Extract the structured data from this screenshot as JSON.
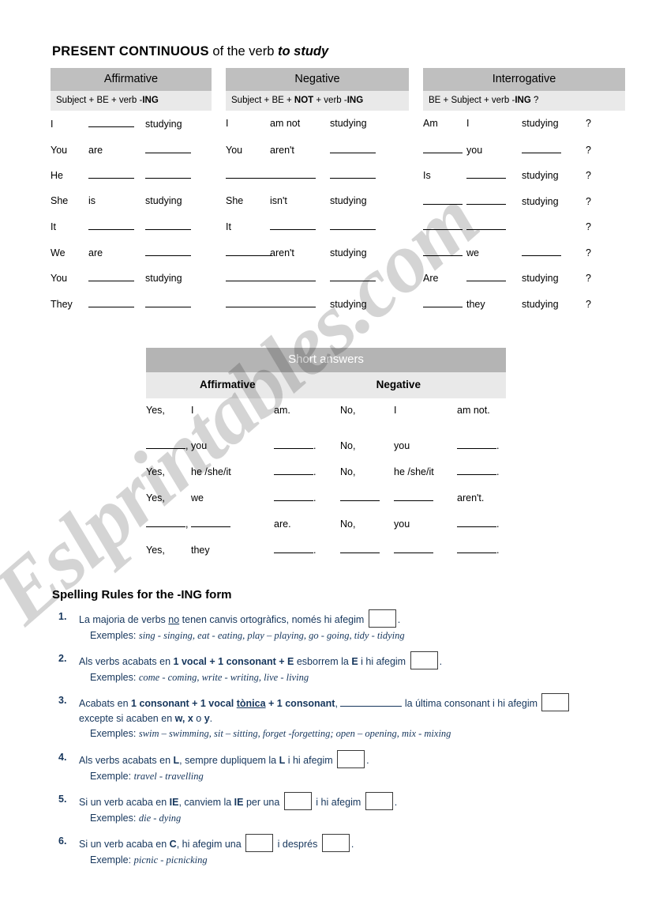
{
  "watermark": {
    "text": "Eslprintables.com"
  },
  "title": {
    "strong": "PRESENT CONTINUOUS",
    "normal": " of the verb ",
    "emphasis": "to study"
  },
  "tables": {
    "affirmative": {
      "header": "Affirmative",
      "formula_plain_1": "Subject + BE + verb -",
      "formula_bold": "ING",
      "rows": [
        {
          "c1": "I",
          "c2": "",
          "c3": "studying"
        },
        {
          "c1": "You",
          "c2": "are",
          "c3": ""
        },
        {
          "c1": "He",
          "c2": "",
          "c3": ""
        },
        {
          "c1": "She",
          "c2": "is",
          "c3": "studying"
        },
        {
          "c1": "It",
          "c2": "",
          "c3": ""
        },
        {
          "c1": "We",
          "c2": "are",
          "c3": ""
        },
        {
          "c1": "You",
          "c2": "",
          "c3": "studying"
        },
        {
          "c1": "They",
          "c2": "",
          "c3": ""
        }
      ]
    },
    "negative": {
      "header": "Negative",
      "formula_plain_1": "Subject + BE + ",
      "formula_bold_1": "NOT",
      "formula_plain_2": " + verb -",
      "formula_bold_2": "ING",
      "rows": [
        {
          "c1": "I",
          "c2": "am not",
          "c3": "studying"
        },
        {
          "c1": "You",
          "c2": "aren't",
          "c3": ""
        },
        {
          "c1": "",
          "c2": "",
          "c3": ""
        },
        {
          "c1": "She",
          "c2": "isn't",
          "c3": "studying"
        },
        {
          "c1": "It",
          "c2": "",
          "c3": ""
        },
        {
          "c1": "",
          "c2": "aren't",
          "c3": "studying"
        },
        {
          "c1": "",
          "c2": "",
          "c3": ""
        },
        {
          "c1": "",
          "c2": "",
          "c3": "studying"
        }
      ]
    },
    "interrogative": {
      "header": "Interrogative",
      "formula_plain_1": "BE + Subject + verb -",
      "formula_bold": "ING",
      "formula_plain_2": " ?",
      "question_mark": "?",
      "rows": [
        {
          "c1": "Am",
          "c2": "I",
          "c3": "studying"
        },
        {
          "c1": "",
          "c2": "you",
          "c3": ""
        },
        {
          "c1": "Is",
          "c2": "",
          "c3": "studying"
        },
        {
          "c1": "",
          "c2": "",
          "c3": "studying"
        },
        {
          "c1": "",
          "c2": "",
          "c3": ""
        },
        {
          "c1": "",
          "c2": "we",
          "c3": ""
        },
        {
          "c1": "Are",
          "c2": "",
          "c3": "studying"
        },
        {
          "c1": "",
          "c2": "they",
          "c3": "studying"
        }
      ]
    }
  },
  "short_answers": {
    "title": "Short answers",
    "col_affirmative": "Affirmative",
    "col_negative": "Negative",
    "rows": [
      {
        "a1": "Yes,",
        "a2": "I",
        "a3": "am.",
        "n1": "No,",
        "n2": "I",
        "n3": "am not."
      },
      {
        "a1": "",
        "a2": "you",
        "a3": "",
        "n1": "No,",
        "n2": "you",
        "n3": ""
      },
      {
        "a1": "Yes,",
        "a2": "he /she/it",
        "a3": "",
        "n1": "No,",
        "n2": "he /she/it",
        "n3": ""
      },
      {
        "a1": "Yes,",
        "a2": "we",
        "a3": "",
        "n1": "",
        "n2": "",
        "n3": "aren't."
      },
      {
        "a1": "",
        "a2": "",
        "a3": "are.",
        "n1": "No,",
        "n2": "you",
        "n3": ""
      },
      {
        "a1": "Yes,",
        "a2": "they",
        "a3": "",
        "n1": "",
        "n2": "",
        "n3": ""
      }
    ]
  },
  "spelling_rules": {
    "title": "Spelling Rules for the -ING form",
    "rules": [
      {
        "num": "1.",
        "text_a": "La majoria de verbs ",
        "underline": "no",
        "text_b": " tenen canvis ortogràfics, només hi afegim ",
        "text_c": ".",
        "examples_label": "Exemples: ",
        "examples": "sing - singing, eat - eating, play – playing, go - going, tidy - tidying"
      },
      {
        "num": "2.",
        "text_a": "Als verbs acabats en ",
        "bold_a": "1 vocal + 1 consonant + E",
        "text_b": "  esborrem la ",
        "bold_b": "E",
        "text_c": " i hi afegim ",
        "text_d": ".",
        "examples_label": "Exemples: ",
        "examples": "come - coming, write - writing, live - living"
      },
      {
        "num": "3.",
        "text_a": "Acabats en ",
        "bold_a": "1 consonant + 1 vocal ",
        "bold_underline": "tònica",
        "bold_b": " + 1 consonant",
        "text_b": ", ",
        "text_c": " la última consonant i hi afegim ",
        "text_d": " excepte si acaben en ",
        "bold_c": "w, x",
        "text_e": " o ",
        "bold_d": "y",
        "text_f": ".",
        "examples_label": "Exemples: ",
        "examples": "swim – swimming, sit – sitting, forget -forgetting; open – opening, mix - mixing"
      },
      {
        "num": "4.",
        "text_a": "Als verbs acabats en ",
        "bold_a": "L",
        "text_b": ", sempre dupliquem la ",
        "bold_b": "L",
        "text_c": " i hi afegim ",
        "text_d": ".",
        "examples_label": "Exemple: ",
        "examples": "travel - travelling"
      },
      {
        "num": "5.",
        "text_a": "Si un verb acaba en ",
        "bold_a": "IE",
        "text_b": ", canviem la ",
        "bold_b": "IE",
        "text_c": " per una ",
        "text_d": " i hi afegim ",
        "text_e": ".",
        "examples_label": "Exemples: ",
        "examples": "die - dying"
      },
      {
        "num": "6.",
        "text_a": "Si un verb acaba en ",
        "bold_a": "C",
        "text_b": ", hi afegim una ",
        "text_c": " i després ",
        "text_d": ".",
        "examples_label": "Exemple: ",
        "examples": "picnic - picnicking"
      }
    ]
  }
}
